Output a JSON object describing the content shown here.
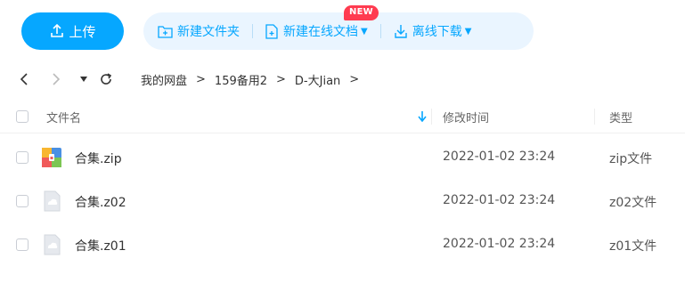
{
  "toolbar": {
    "upload_label": "上传",
    "new_folder_label": "新建文件夹",
    "new_online_doc_label": "新建在线文档",
    "new_badge": "NEW",
    "offline_download_label": "离线下载"
  },
  "breadcrumb": {
    "items": [
      "我的网盘",
      "159备用2",
      "D-大Jian"
    ],
    "separator": ">"
  },
  "table": {
    "columns": {
      "name": "文件名",
      "modified": "修改时间",
      "type": "类型"
    },
    "rows": [
      {
        "name": "合集.zip",
        "modified": "2022-01-02 23:24",
        "type": "zip文件",
        "icon": "zip-archive-icon"
      },
      {
        "name": "合集.z02",
        "modified": "2022-01-02 23:24",
        "type": "z02文件",
        "icon": "unknown-file-icon"
      },
      {
        "name": "合集.z01",
        "modified": "2022-01-02 23:24",
        "type": "z01文件",
        "icon": "unknown-file-icon"
      }
    ]
  },
  "colors": {
    "accent": "#06a7ff",
    "accent_bg": "#eaf5ff",
    "badge": "#ff3b50"
  }
}
